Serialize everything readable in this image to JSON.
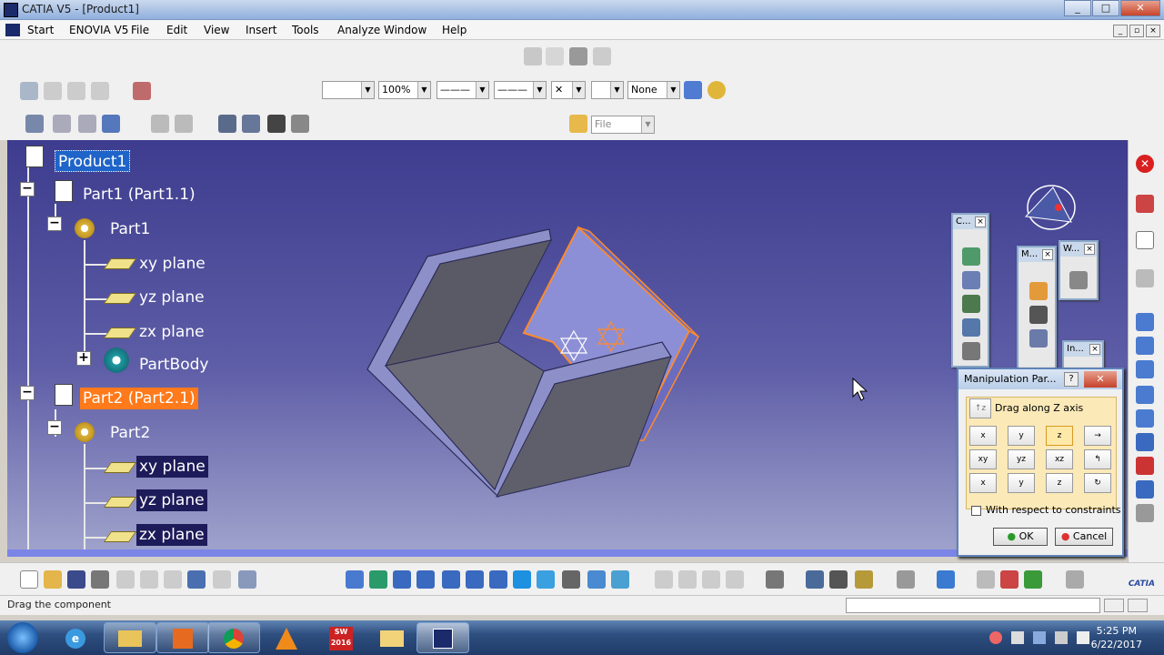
{
  "window": {
    "title": "CATIA V5 - [Product1]",
    "controls": [
      "_",
      "□",
      "✕"
    ]
  },
  "menubar": {
    "items": [
      "Start",
      "ENOVIA V5",
      "File",
      "Edit",
      "View",
      "Insert",
      "Tools",
      "Analyze",
      "Window",
      "Help"
    ]
  },
  "toolbar": {
    "color_value": "",
    "transparency_value": "100%",
    "linetype_value": "———",
    "thickness_value": "———",
    "point_value": "✕",
    "layer_value": "None",
    "file_filter": "File"
  },
  "tree": {
    "nodes": [
      {
        "label": "Product1",
        "level": 0,
        "icon": "product-icon",
        "state": "selected-blue"
      },
      {
        "label": "Part1 (Part1.1)",
        "level": 1,
        "icon": "part-instance-icon",
        "state": "normal"
      },
      {
        "label": "Part1",
        "level": 2,
        "icon": "part-gear-icon",
        "state": "normal"
      },
      {
        "label": "xy plane",
        "level": 3,
        "icon": "plane-icon",
        "state": "normal"
      },
      {
        "label": "yz plane",
        "level": 3,
        "icon": "plane-icon",
        "state": "normal"
      },
      {
        "label": "zx plane",
        "level": 3,
        "icon": "plane-icon",
        "state": "normal"
      },
      {
        "label": "PartBody",
        "level": 3,
        "icon": "partbody-icon",
        "state": "normal"
      },
      {
        "label": "Part2 (Part2.1)",
        "level": 1,
        "icon": "part-instance-icon",
        "state": "selected-orange"
      },
      {
        "label": "Part2",
        "level": 2,
        "icon": "part-gear-icon",
        "state": "normal"
      },
      {
        "label": "xy plane",
        "level": 3,
        "icon": "plane-icon",
        "state": "highlight"
      },
      {
        "label": "yz plane",
        "level": 3,
        "icon": "plane-icon",
        "state": "highlight"
      },
      {
        "label": "zx plane",
        "level": 3,
        "icon": "plane-icon",
        "state": "highlight"
      }
    ]
  },
  "floating_toolbars": [
    {
      "title": "C...",
      "close": "×"
    },
    {
      "title": "M...",
      "close": "×"
    },
    {
      "title": "W...",
      "close": "×"
    },
    {
      "title": "In...",
      "close": "×"
    }
  ],
  "manipulation": {
    "title": "Manipulation Par...",
    "help": "?",
    "close": "✕",
    "current_mode": "Drag along Z axis",
    "grid": [
      [
        "x",
        "y",
        "z",
        "→"
      ],
      [
        "xy",
        "yz",
        "xz",
        "↰"
      ],
      [
        "x",
        "y",
        "z",
        "↻"
      ]
    ],
    "constraint_label": "With respect to constraints",
    "constraint_checked": false,
    "ok": "OK",
    "cancel": "Cancel"
  },
  "statusbar": {
    "message": "Drag the component",
    "command_value": ""
  },
  "taskbar": {
    "time": "5:25 PM",
    "date": "6/22/2017",
    "sw_label": "SW\n2016"
  },
  "colors": {
    "viewport_top": "#3d3c8e",
    "viewport_bottom": "#a0a3cc",
    "selection_orange": "#ff7a1a",
    "selection_blue": "#1f64c8"
  }
}
